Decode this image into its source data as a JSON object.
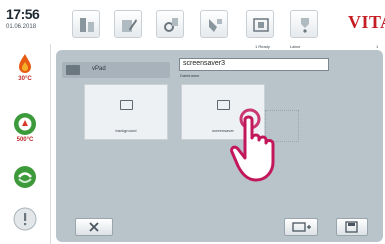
{
  "status": {
    "time": "17:56",
    "date": "01.06.2018",
    "upper_temp": "30°C",
    "lower_temp": "500°C"
  },
  "brand": {
    "logo": "VITA"
  },
  "toolbar": {
    "icons": [
      "program-icon",
      "edit-icon",
      "settings-icon",
      "assistant-icon",
      "media-icon",
      "help-icon"
    ],
    "sub_status": [
      "1 Ready",
      "Labor",
      "1"
    ]
  },
  "dialog": {
    "folder_label": "vPad",
    "filename_value": "screensaver3",
    "filename_caption": "Dateiname",
    "folders": [
      {
        "label": "background"
      },
      {
        "label": "screensaver"
      }
    ]
  },
  "colors": {
    "accent": "#c41e24",
    "flame": "#e85a12",
    "green": "#3c9a3a",
    "panel": "#b9c3ca"
  }
}
